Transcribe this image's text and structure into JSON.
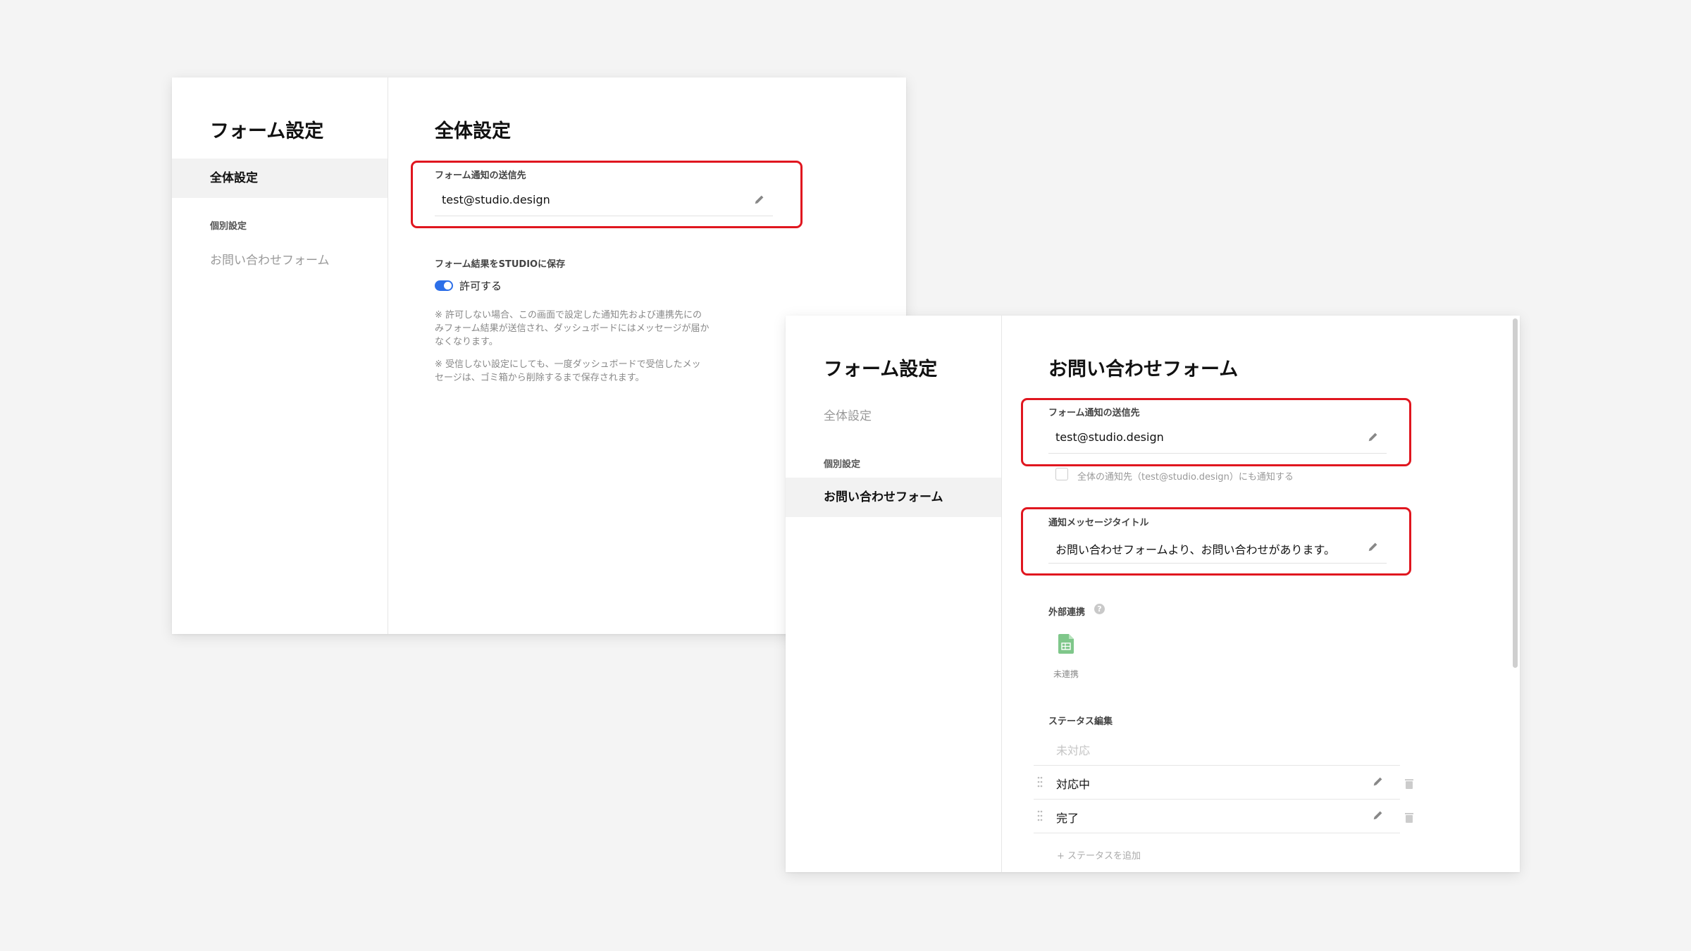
{
  "window1": {
    "sidebar": {
      "title": "フォーム設定",
      "items": [
        {
          "label": "全体設定",
          "active": true
        },
        {
          "label": "個別設定",
          "group": true
        },
        {
          "label": "お問い合わせフォーム",
          "active": false
        }
      ]
    },
    "main": {
      "title": "全体設定",
      "notify_label": "フォーム通知の送信先",
      "notify_value": "test@studio.design",
      "save_label": "フォーム結果をSTUDIOに保存",
      "toggle_label": "許可する",
      "toggle_on": true,
      "note1_lines": [
        "※ 許可しない場合、この画面で設定した通知先および連携先にの",
        "みフォーム結果が送信され、ダッシュボードにはメッセージが届か",
        "なくなります。"
      ],
      "note2_lines": [
        "※ 受信しない設定にしても、一度ダッシュボードで受信したメッ",
        "セージは、ゴミ箱から削除するまで保存されます。"
      ]
    }
  },
  "window2": {
    "sidebar": {
      "title": "フォーム設定",
      "items": [
        {
          "label": "全体設定",
          "active": false
        },
        {
          "label": "個別設定",
          "group": true
        },
        {
          "label": "お問い合わせフォーム",
          "active": true
        }
      ]
    },
    "main": {
      "title": "お問い合わせフォーム",
      "notify_label": "フォーム通知の送信先",
      "notify_value": "test@studio.design",
      "also_notify_label": "全体の通知先（test@studio.design）にも通知する",
      "msg_title_label": "通知メッセージタイトル",
      "msg_title_value": "お問い合わせフォームより、お問い合わせがあります。",
      "external_label": "外部連携",
      "help_glyph": "?",
      "sheet_status": "未連携",
      "status_label": "ステータス編集",
      "statuses": [
        "未対応",
        "対応中",
        "完了"
      ],
      "add_status": "+ ステータスを追加"
    }
  },
  "colors": {
    "highlight": "#e0161f",
    "toggle": "#2d6fe8",
    "sheet": "#7fc78a"
  },
  "icons": {
    "pencil": "pencil-icon",
    "help": "help-icon",
    "sheet": "spreadsheet-icon",
    "grip": "drag-handle-icon",
    "trash": "trash-icon"
  }
}
